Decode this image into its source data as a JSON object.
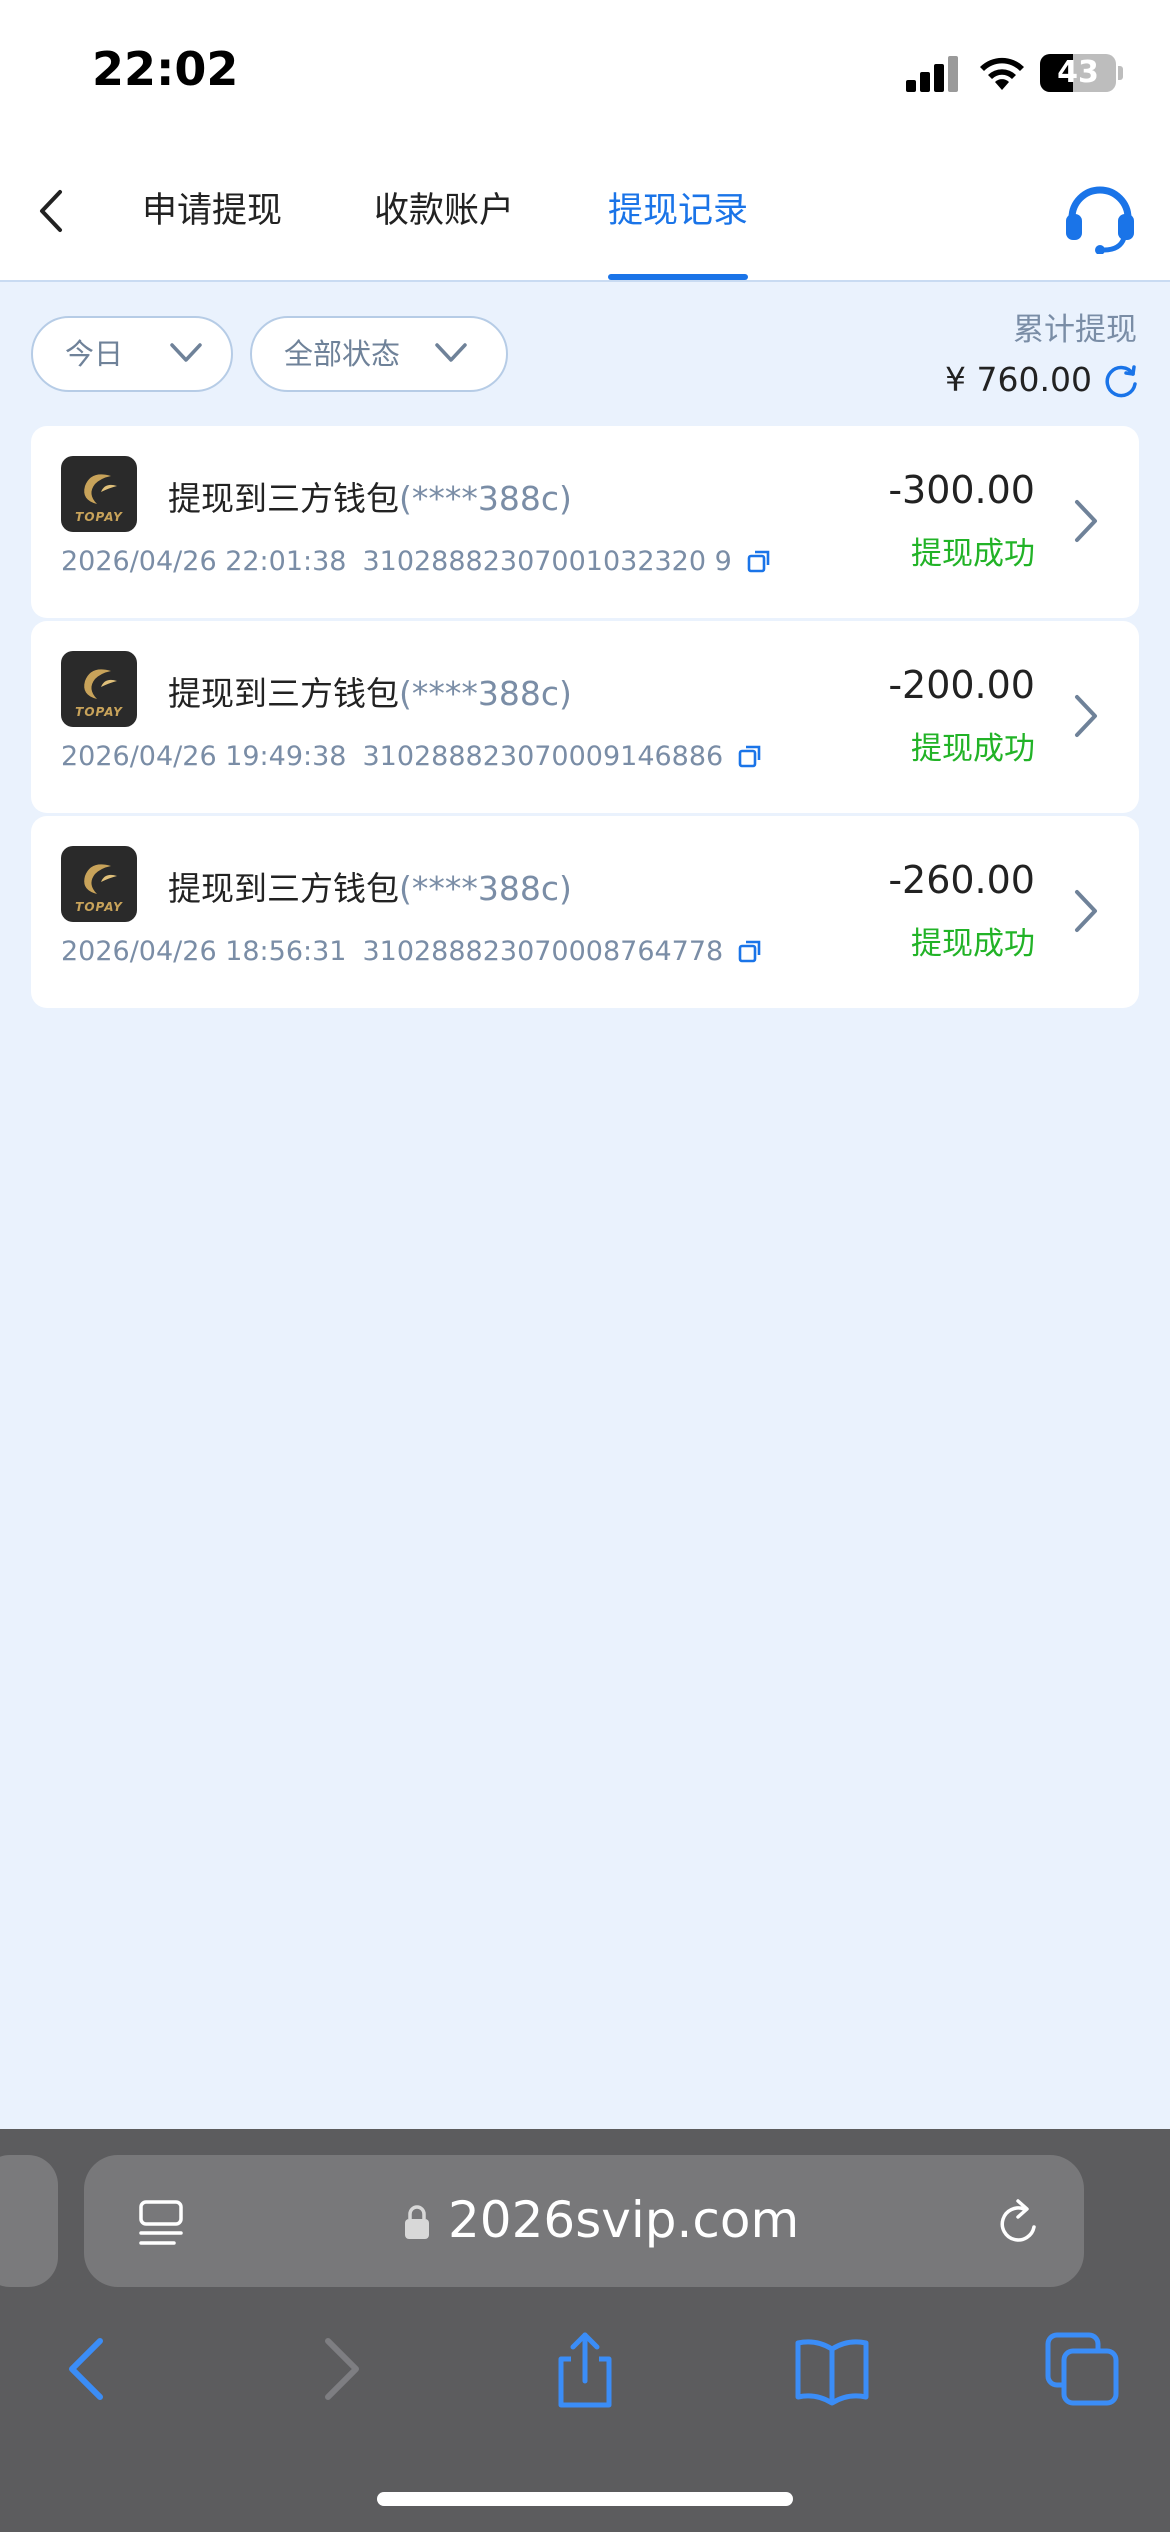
{
  "status_bar": {
    "time": "22:02",
    "battery": "43",
    "battery_level": 0.43
  },
  "tabs": [
    {
      "label": "申请提现",
      "active": false
    },
    {
      "label": "收款账户",
      "active": false
    },
    {
      "label": "提现记录",
      "active": true
    }
  ],
  "filters": {
    "date": "今日",
    "status": "全部状态"
  },
  "summary": {
    "label": "累计提现",
    "amount": "¥ 760.00"
  },
  "records": [
    {
      "title": "提现到三方钱包",
      "account": "(****388c)",
      "datetime": "2026/04/26 22:01:38",
      "order_id": "31028882307001032320 9",
      "amount": "-300.00",
      "status": "提现成功"
    },
    {
      "title": "提现到三方钱包",
      "account": "(****388c)",
      "datetime": "2026/04/26 19:49:38",
      "order_id": "310288823070009146886",
      "amount": "-200.00",
      "status": "提现成功"
    },
    {
      "title": "提现到三方钱包",
      "account": "(****388c)",
      "datetime": "2026/04/26 18:56:31",
      "order_id": "310288823070008764778",
      "amount": "-260.00",
      "status": "提现成功"
    }
  ],
  "wallet_logo_text": "TOPAY",
  "browser": {
    "url": "2026svip.com"
  },
  "colors": {
    "accent": "#1a74e8",
    "success": "#22b327",
    "background": "#eaf2fd"
  }
}
